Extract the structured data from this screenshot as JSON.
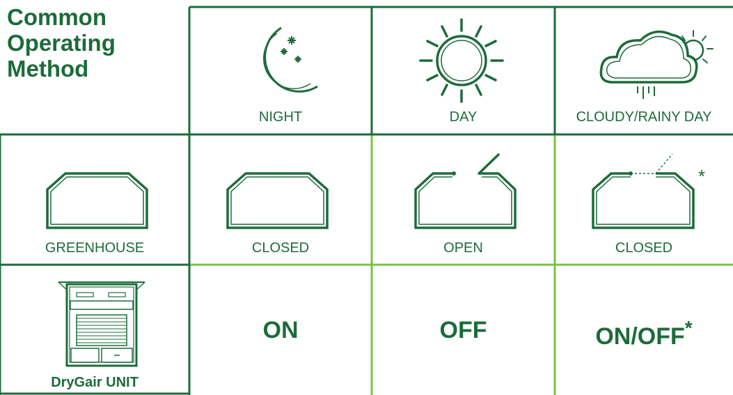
{
  "title_lines": [
    "Common",
    "Operating",
    "Method"
  ],
  "columns": [
    {
      "label": "NIGHT",
      "icon": "moon-stars-icon"
    },
    {
      "label": "DAY",
      "icon": "sun-icon"
    },
    {
      "label": "CLOUDY/RAINY DAY",
      "icon": "cloud-sun-rain-icon"
    }
  ],
  "rows": [
    {
      "header": "GREENHOUSE",
      "icon": "greenhouse-icon",
      "values": [
        "CLOSED",
        "OPEN",
        "CLOSED"
      ],
      "note_mark": "*"
    },
    {
      "header": "DryGair UNIT",
      "icon": "drygair-unit-icon",
      "values": [
        "ON",
        "OFF",
        "ON/OFF"
      ],
      "note_mark": "*"
    }
  ],
  "colors": {
    "dark_green": "#1d6b3a",
    "light_green": "#7cc142"
  }
}
